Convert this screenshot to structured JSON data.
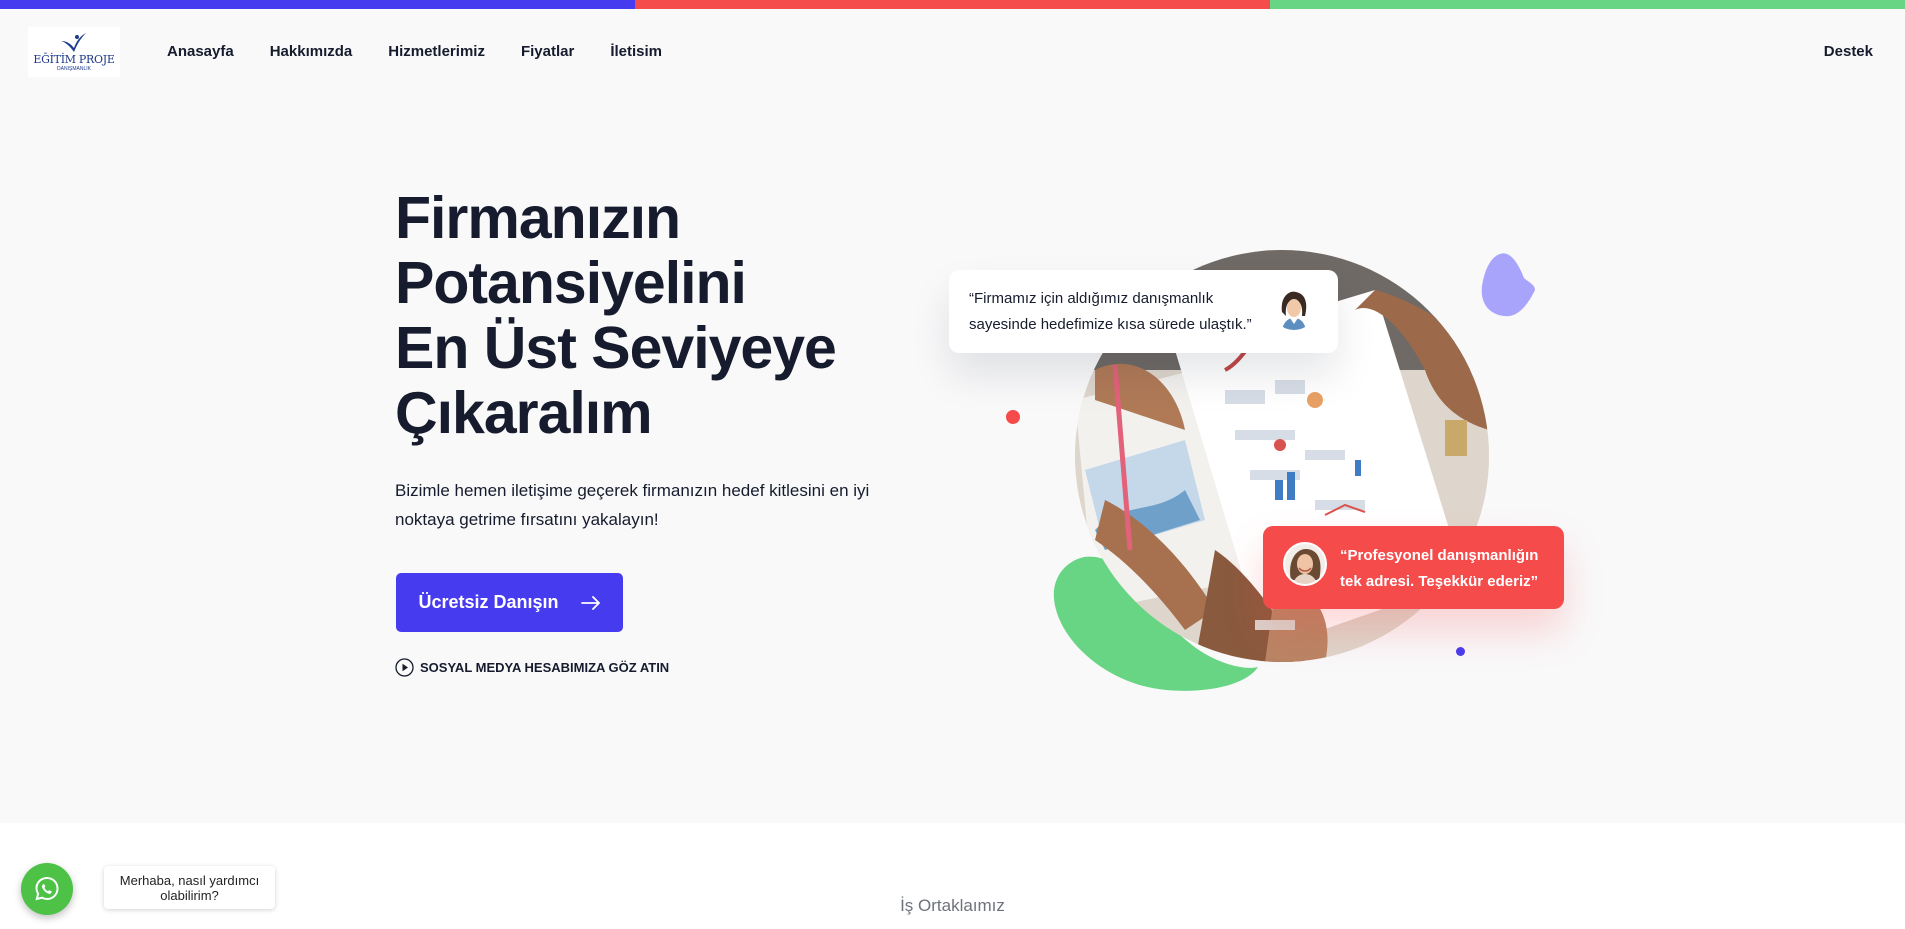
{
  "colors": {
    "top_bar": [
      "#473bf0",
      "#f64b4b",
      "#68d585"
    ],
    "primary": "#473bf0",
    "accent_red": "#f64b4b",
    "accent_green": "#68d585",
    "accent_purple": "#a9a4fb",
    "whatsapp": "#4dc247"
  },
  "nav": {
    "logo_text": "EĞİTİM PROJE",
    "logo_sub": "DANIŞMANLIK",
    "links": [
      "Anasayfa",
      "Hakkımızda",
      "Hizmetlerimiz",
      "Fiyatlar",
      "İletisim"
    ],
    "right_link": "Destek"
  },
  "hero": {
    "headline_lines": [
      "Firmanızın",
      "Potansiyelini",
      "En Üst Seviyeye",
      "Çıkaralım"
    ],
    "subtext": "Bizimle hemen iletişime geçerek firmanızın hedef kitlesini en iyi noktaya getrime fırsatını yakalayın!",
    "cta_label": "Ücretsiz Danışın",
    "cta_icon": "arrow-right-icon",
    "social_label": "SOSYAL MEDYA HESABIMIZA GÖZ ATIN",
    "social_icon": "play-circle-icon"
  },
  "testimonials": {
    "first": "“Firmamız için aldığımız danışmanlık sayesinde hedefimize kısa sürede ulaştık.”",
    "second": "“Profesyonel danışmanlığın tek adresi. Teşekkür ederiz”"
  },
  "partners": {
    "title": "İş Ortaklaımız"
  },
  "whatsapp": {
    "icon": "whatsapp-icon",
    "bubble_text": "Merhaba, nasıl yardımcı olabilirim?"
  }
}
